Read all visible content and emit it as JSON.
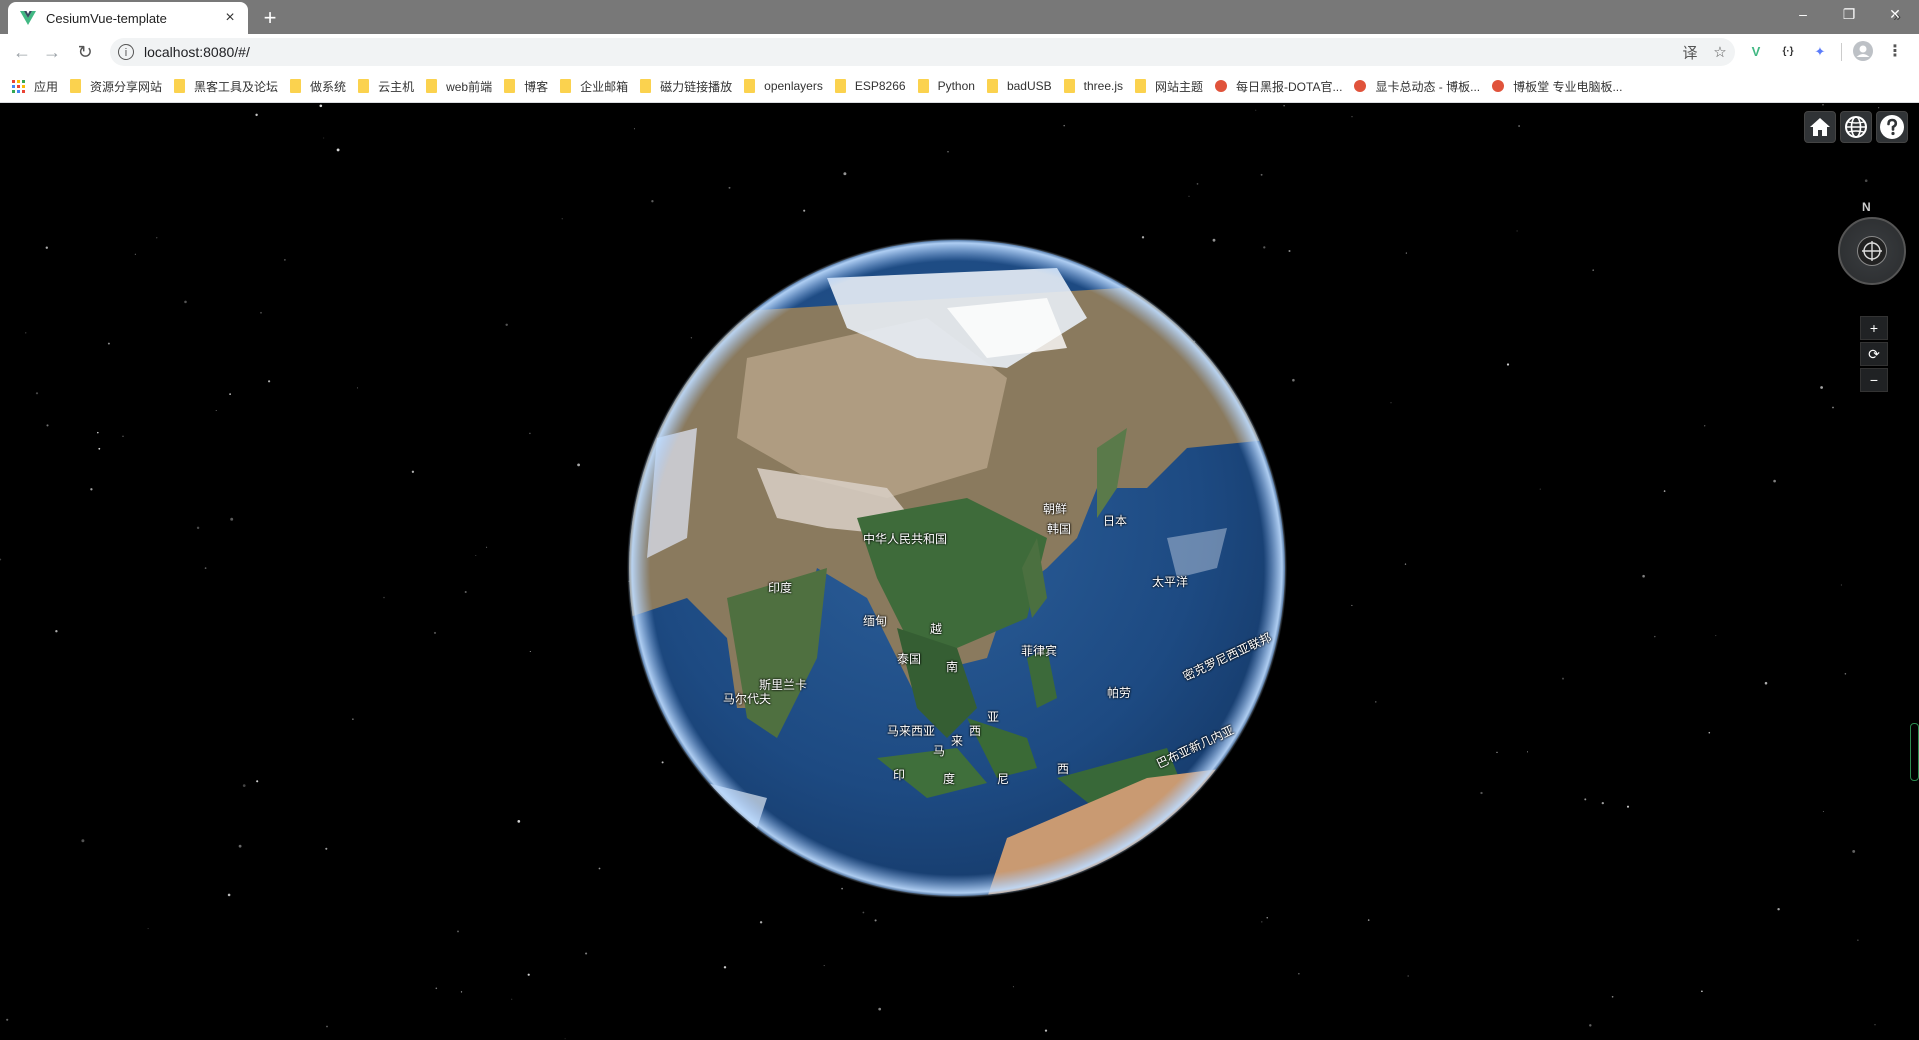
{
  "browser": {
    "tab_title": "CesiumVue-template",
    "tab_close": "×",
    "new_tab": "+",
    "window_controls": {
      "minimize": "–",
      "restore": "❐",
      "close": "✕"
    },
    "nav": {
      "back": "←",
      "forward": "→",
      "reload": "↻"
    },
    "url": "localhost:8080/#/",
    "omnibox_icons": {
      "translate": "译",
      "bookmark_star": "☆"
    },
    "extensions": [
      "V",
      "{·}",
      "✦"
    ],
    "bookmarks_more": "»"
  },
  "bookmarks": [
    {
      "label": "应用",
      "type": "apps"
    },
    {
      "label": "资源分享网站",
      "type": "folder"
    },
    {
      "label": "黑客工具及论坛",
      "type": "folder"
    },
    {
      "label": "做系统",
      "type": "folder"
    },
    {
      "label": "云主机",
      "type": "folder"
    },
    {
      "label": "web前端",
      "type": "folder"
    },
    {
      "label": "博客",
      "type": "folder"
    },
    {
      "label": "企业邮箱",
      "type": "folder"
    },
    {
      "label": "磁力链接播放",
      "type": "folder"
    },
    {
      "label": "openlayers",
      "type": "folder"
    },
    {
      "label": "ESP8266",
      "type": "folder"
    },
    {
      "label": "Python",
      "type": "folder"
    },
    {
      "label": "badUSB",
      "type": "folder"
    },
    {
      "label": "three.js",
      "type": "folder"
    },
    {
      "label": "网站主题",
      "type": "folder"
    },
    {
      "label": "每日黑报-DOTA官...",
      "type": "site"
    },
    {
      "label": "显卡总动态 - 博板...",
      "type": "site"
    },
    {
      "label": "博板堂 专业电脑板...",
      "type": "site"
    }
  ],
  "cesium": {
    "compass_north": "N",
    "zoom_in": "+",
    "zoom_reset": "⟳",
    "zoom_out": "−"
  },
  "map_labels": [
    {
      "text": "中华人民共和国"
    },
    {
      "text": "朝鲜"
    },
    {
      "text": "韩国"
    },
    {
      "text": "日本"
    },
    {
      "text": "印度"
    },
    {
      "text": "缅甸"
    },
    {
      "text": "泰国"
    },
    {
      "text": "越"
    },
    {
      "text": "南"
    },
    {
      "text": "菲律宾"
    },
    {
      "text": "斯里兰卡"
    },
    {
      "text": "马尔代夫"
    },
    {
      "text": "马来西亚"
    },
    {
      "text": "马"
    },
    {
      "text": "来"
    },
    {
      "text": "西"
    },
    {
      "text": "亚"
    },
    {
      "text": "印"
    },
    {
      "text": "度"
    },
    {
      "text": "尼"
    },
    {
      "text": "西"
    },
    {
      "text": "帕劳"
    },
    {
      "text": "太平洋"
    },
    {
      "text": "密克罗尼西亚联邦"
    },
    {
      "text": "巴布亚新几内亚"
    }
  ]
}
